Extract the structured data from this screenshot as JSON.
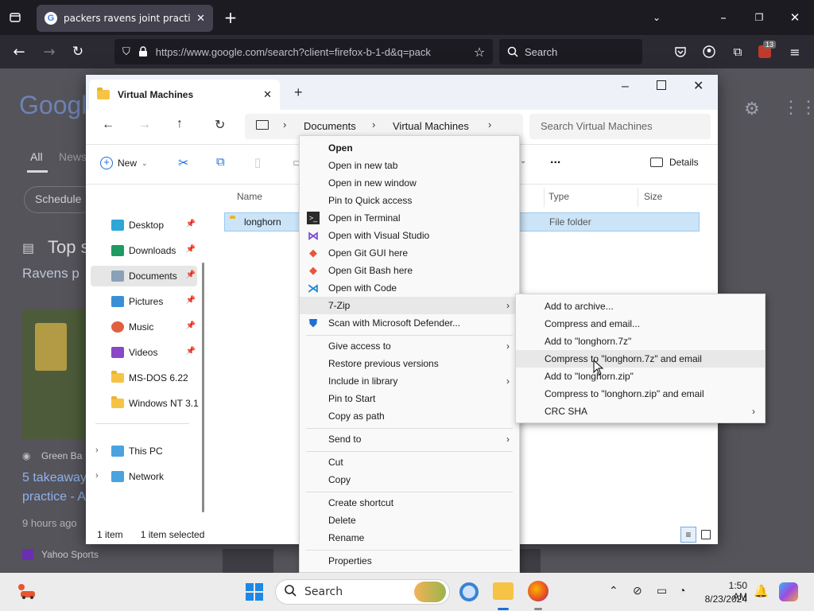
{
  "browser": {
    "tab_title": "packers ravens joint practice - G",
    "url": "https://www.google.com/search?client=firefox-b-1-d&q=pack",
    "search_placeholder": "Search",
    "extension_badge": "13",
    "google_logo": "Googl",
    "google_tabs": [
      "All",
      "News"
    ],
    "google_schedule": "Schedule",
    "top_stories": "Top s",
    "ravens_line": "Ravens p",
    "green_bay": "Green Ba",
    "takeaway": "5 takeaway",
    "practice": "practice - A",
    "hours_ago": "9 hours ago",
    "yahoo": "Yahoo Sports"
  },
  "explorer": {
    "tab_title": "Virtual Machines",
    "breadcrumb": [
      "Documents",
      "Virtual Machines"
    ],
    "search_placeholder": "Search Virtual Machines",
    "toolbar": {
      "new_label": "New",
      "details_label": "Details",
      "more_label": "..."
    },
    "columns": {
      "name": "Name",
      "type": "Type",
      "size": "Size"
    },
    "file": {
      "name": "longhorn",
      "type": "File folder"
    },
    "sidebar": [
      {
        "label": "Desktop",
        "icon": "desktop-icon",
        "pinned": true
      },
      {
        "label": "Downloads",
        "icon": "downloads-icon",
        "pinned": true
      },
      {
        "label": "Documents",
        "icon": "documents-icon",
        "pinned": true
      },
      {
        "label": "Pictures",
        "icon": "pictures-icon",
        "pinned": true
      },
      {
        "label": "Music",
        "icon": "music-icon",
        "pinned": true
      },
      {
        "label": "Videos",
        "icon": "videos-icon",
        "pinned": true
      },
      {
        "label": "MS-DOS 6.22",
        "icon": "folder-icon",
        "pinned": false
      },
      {
        "label": "Windows NT 3.1",
        "icon": "folder-icon",
        "pinned": false
      },
      {
        "label": "This PC",
        "icon": "this-pc-icon",
        "pinned": false
      },
      {
        "label": "Network",
        "icon": "network-icon",
        "pinned": false
      }
    ],
    "status": {
      "count": "1 item",
      "selected": "1 item selected"
    }
  },
  "context_menu": [
    {
      "label": "Open",
      "bold": true
    },
    {
      "label": "Open in new tab"
    },
    {
      "label": "Open in new window"
    },
    {
      "label": "Pin to Quick access"
    },
    {
      "label": "Open in Terminal",
      "icon": "terminal-icon"
    },
    {
      "label": "Open with Visual Studio",
      "icon": "visual-studio-icon"
    },
    {
      "label": "Open Git GUI here",
      "icon": "git-icon"
    },
    {
      "label": "Open Git Bash here",
      "icon": "git-icon"
    },
    {
      "label": "Open with Code",
      "icon": "vscode-icon"
    },
    {
      "label": "7-Zip",
      "submenu": true
    },
    {
      "label": "Scan with Microsoft Defender...",
      "icon": "defender-icon"
    },
    {
      "label": "Give access to",
      "submenu": true
    },
    {
      "label": "Restore previous versions"
    },
    {
      "label": "Include in library",
      "submenu": true
    },
    {
      "label": "Pin to Start"
    },
    {
      "label": "Copy as path"
    },
    {
      "label": "Send to",
      "submenu": true
    },
    {
      "label": "Cut"
    },
    {
      "label": "Copy"
    },
    {
      "label": "Create shortcut"
    },
    {
      "label": "Delete"
    },
    {
      "label": "Rename"
    },
    {
      "label": "Properties"
    }
  ],
  "zip_menu": [
    {
      "label": "Add to archive..."
    },
    {
      "label": "Compress and email..."
    },
    {
      "label": "Add to \"longhorn.7z\""
    },
    {
      "label": "Compress to \"longhorn.7z\" and email"
    },
    {
      "label": "Add to \"longhorn.zip\""
    },
    {
      "label": "Compress to \"longhorn.zip\" and email"
    },
    {
      "label": "CRC SHA",
      "submenu": true
    }
  ],
  "taskbar": {
    "search_placeholder": "Search",
    "time": "1:50 AM",
    "date": "8/23/2024"
  }
}
